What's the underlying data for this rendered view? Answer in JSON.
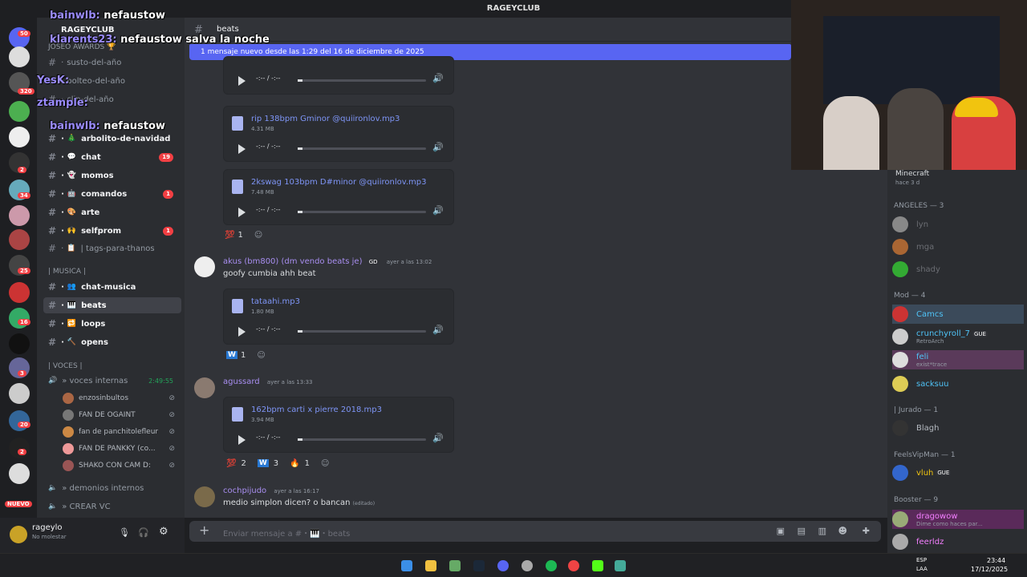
{
  "window": {
    "title": "RAGEYCLUB"
  },
  "server": {
    "name": "RAGEYCLUB",
    "events": "JOSEO AWARDS 🏆"
  },
  "channels": [
    {
      "name": "susto-del-año",
      "emoji": "",
      "badge": "",
      "bright": false,
      "sel": false
    },
    {
      "name": "bolteo-del-año",
      "emoji": "",
      "badge": "",
      "bright": false,
      "sel": false
    },
    {
      "name": "clip-del-año",
      "emoji": "",
      "badge": "",
      "bright": false,
      "sel": false
    },
    {
      "name": "arbolito-de-navidad",
      "emoji": "🎄",
      "badge": "",
      "bright": true,
      "sel": false
    },
    {
      "name": "chat",
      "emoji": "💬",
      "badge": "19",
      "bright": true,
      "sel": false
    },
    {
      "name": "momos",
      "emoji": "👻",
      "badge": "",
      "bright": true,
      "sel": false
    },
    {
      "name": "comandos",
      "emoji": "🤖",
      "badge": "1",
      "bright": true,
      "sel": false
    },
    {
      "name": "arte",
      "emoji": "🎨",
      "badge": "",
      "bright": true,
      "sel": false
    },
    {
      "name": "selfprom",
      "emoji": "🙌",
      "badge": "1",
      "bright": true,
      "sel": false
    },
    {
      "name": "| tags-para-thanos",
      "emoji": "📋",
      "badge": "",
      "bright": false,
      "sel": false
    }
  ],
  "music_category": "| MUSICA |",
  "music_channels": [
    {
      "name": "chat-musica",
      "emoji": "👥"
    },
    {
      "name": "beats",
      "emoji": "🎹"
    },
    {
      "name": "loops",
      "emoji": "🔁"
    },
    {
      "name": "opens",
      "emoji": "🔨"
    }
  ],
  "voice_category": "| VOCES |",
  "voice_channel": {
    "name": "» voces internas",
    "time": "2:49:55"
  },
  "voice_users": [
    "enzosinbultos",
    "FAN DE OGAINT",
    "fan de panchitolefleur",
    "FAN DE PANKKY (co...",
    "SHAKO CON CAM D:"
  ],
  "voice_channels_more": [
    "» demonios internos",
    "» CREAR VC"
  ],
  "user": {
    "name": "rageylo",
    "status": "No molestar"
  },
  "channel_header": {
    "name": "beats"
  },
  "new_messages": "1 mensaje nuevo desde las 1:29 del 16 de diciembre de 2025",
  "attachments_top": [
    {
      "name": "rip 138bpm Gminor @quiironlov.mp3",
      "size": "4.31 MB",
      "time": "-:-- / -:--"
    },
    {
      "name": "2kswag 103bpm D#minor @quiironlov.mp3",
      "size": "7.48 MB",
      "time": "-:-- / -:--"
    }
  ],
  "reaction1": {
    "emoji": "💯",
    "count": "1"
  },
  "msg1": {
    "author": "akus (bm800) (dm vendo beats je)",
    "tag": "GD",
    "time": "ayer a las 13:02",
    "text": "goofy cumbia ahh beat",
    "file": "tataahi.mp3",
    "size": "1.80 MB",
    "reaction": "1"
  },
  "msg2": {
    "author": "agussard",
    "time": "ayer a las 13:33",
    "file": "162bpm carti x pierre 2018.mp3",
    "size": "3.94 MB",
    "r1": "2",
    "r2": "3",
    "r3": "1"
  },
  "msg3": {
    "author": "cochpijudo",
    "time": "ayer a las 16:17",
    "text": "medio simplon dicen? o bancan",
    "edited": "(editado)"
  },
  "audio_time": "-:-- / -:--",
  "composer_placeholder": "Enviar mensaje a #・🎹・beats",
  "members": {
    "activity": {
      "title": "Minecraft",
      "sub": "hace 3 d"
    },
    "angeles": "ANGELES — 3",
    "angeles_list": [
      "lyn",
      "mga",
      "shady"
    ],
    "mod": "Mod — 4",
    "mod_list": [
      {
        "name": "Camcs",
        "sub": ""
      },
      {
        "name": "crunchyroll_7",
        "sub": "RetroArch",
        "tag": "GUE"
      },
      {
        "name": "feli",
        "sub": "exist*trace"
      },
      {
        "name": "sacksuu",
        "sub": ""
      }
    ],
    "jurado": "| Jurado — 1",
    "jurado_list": [
      "Blagh"
    ],
    "feels": "FeelsVipMan — 1",
    "feels_list": [
      {
        "name": "vluh",
        "tag": "GUE"
      }
    ],
    "booster": "Booster — 9",
    "booster_list": [
      {
        "name": "dragowow",
        "sub": "Dime como haces par..."
      },
      {
        "name": "feerldz",
        "sub": ""
      }
    ]
  },
  "overlay_chat": [
    {
      "user": "bainwlb:",
      "text": "nefaustow"
    },
    {
      "user": "klarents23:",
      "text": "nefaustow salva la noche"
    },
    {
      "user": "YesK:",
      "text": ""
    },
    {
      "user": "ztample:",
      "text": ""
    },
    {
      "user": "bainwlb:",
      "text": "nefaustow"
    }
  ],
  "guild_badges": [
    "50",
    "320",
    "2",
    "34",
    "25",
    "16",
    "3",
    "20",
    "2"
  ],
  "guild_new": "NUEVO",
  "taskbar": {
    "lang": "ESP",
    "lang2": "LAA",
    "time": "23:44",
    "date": "17/12/2025"
  },
  "colors": {
    "accent": "#5865f2",
    "mention": "#a88ef0",
    "link": "#7e95f6",
    "badge": "#f23f43",
    "online": "#23a55a"
  }
}
